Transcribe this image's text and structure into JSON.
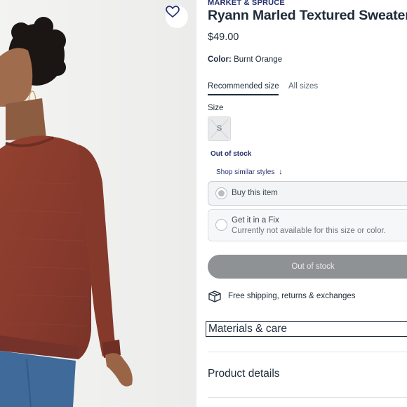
{
  "product": {
    "brand": "MARKET & SPRUCE",
    "title": "Ryann Marled Textured Sweater",
    "price": "$49.00",
    "color_label": "Color:",
    "color_value": "Burnt Orange"
  },
  "size_tabs": [
    {
      "label": "Recommended size",
      "active": true
    },
    {
      "label": "All sizes",
      "active": false
    }
  ],
  "size": {
    "label": "Size",
    "options": [
      {
        "value": "S",
        "available": false
      }
    ],
    "out_of_stock_note": "Out of stock",
    "shop_similar": "Shop similar styles"
  },
  "purchase_options": [
    {
      "title": "Buy this item",
      "selected": true
    },
    {
      "title": "Get it in a Fix",
      "subtitle": "Currently not available for this size or color."
    }
  ],
  "cta": {
    "label": "Out of stock"
  },
  "shipping": {
    "text": "Free shipping, returns & exchanges",
    "icon": "box-icon"
  },
  "sections": [
    {
      "title": "Materials & care"
    },
    {
      "title": "Product details"
    }
  ],
  "colors": {
    "navy": "#25306e",
    "text": "#1e2b3a",
    "sweater": "#8a3a2e",
    "button_disabled": "#8f9295"
  },
  "icons": [
    "heart-icon",
    "box-icon",
    "arrow-down-icon"
  ]
}
